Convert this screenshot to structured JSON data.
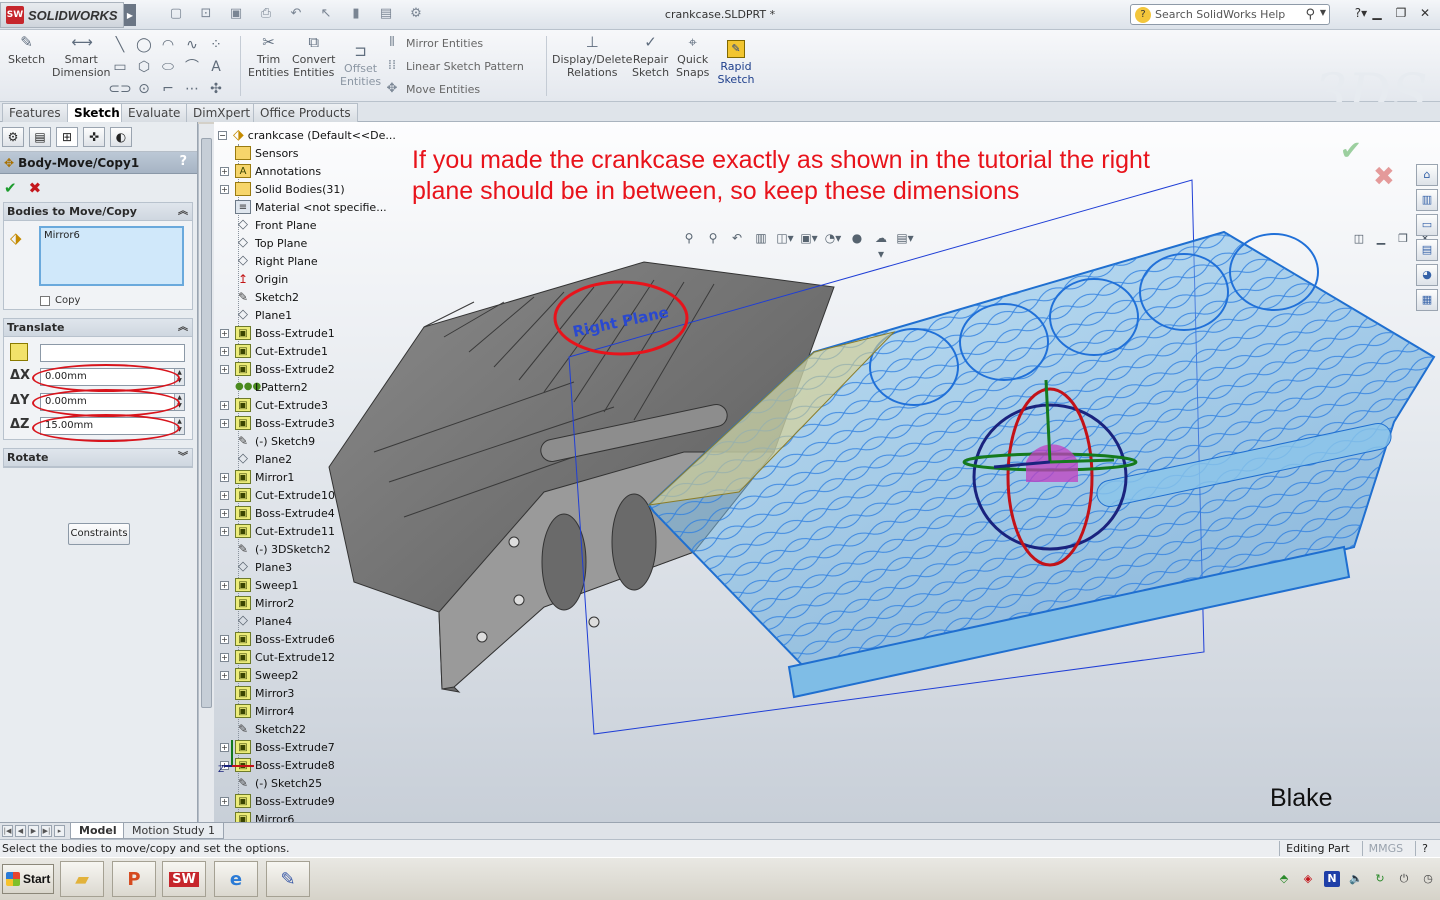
{
  "app": {
    "brand": "SOLIDWORKS",
    "doc_title": "crankcase.SLDPRT *"
  },
  "search": {
    "placeholder": "Search SolidWorks Help"
  },
  "commands": {
    "sketch": "Sketch",
    "smart_dimension_1": "Smart",
    "smart_dimension_2": "Dimension",
    "trim_1": "Trim",
    "trim_2": "Entities",
    "convert_1": "Convert",
    "convert_2": "Entities",
    "offset_1": "Offset",
    "offset_2": "Entities",
    "mirror_entities": "Mirror Entities",
    "linear_pattern": "Linear Sketch Pattern",
    "move_entities": "Move Entities",
    "display_delete_1": "Display/Delete",
    "display_delete_2": "Relations",
    "repair_1": "Repair",
    "repair_2": "Sketch",
    "quick_snaps_1": "Quick",
    "quick_snaps_2": "Snaps",
    "rapid_1": "Rapid",
    "rapid_2": "Sketch"
  },
  "tabs": [
    "Features",
    "Sketch",
    "Evaluate",
    "DimXpert",
    "Office Products"
  ],
  "property_manager": {
    "title": "Body-Move/Copy1",
    "help": "?",
    "bodies_group": "Bodies to Move/Copy",
    "selected_body": "Mirror6",
    "copy_label": "Copy",
    "translate_group": "Translate",
    "dx_label": "ΔX",
    "dy_label": "ΔY",
    "dz_label": "ΔZ",
    "dx": "0.00mm",
    "dy": "0.00mm",
    "dz": "15.00mm",
    "rotate_group": "Rotate",
    "constraints": "Constraints"
  },
  "tree": {
    "root": "crankcase  (Default<<De...",
    "items": [
      {
        "label": "Sensors",
        "icon": "sensor-icon"
      },
      {
        "label": "Annotations",
        "icon": "annotation-icon"
      },
      {
        "label": "Solid Bodies(31)",
        "icon": "folder-icon"
      },
      {
        "label": "Material <not specifie...",
        "icon": "material-icon"
      },
      {
        "label": "Front Plane",
        "icon": "plane-icon"
      },
      {
        "label": "Top Plane",
        "icon": "plane-icon"
      },
      {
        "label": "Right Plane",
        "icon": "plane-icon"
      },
      {
        "label": "Origin",
        "icon": "origin-icon"
      },
      {
        "label": "Sketch2",
        "icon": "sketch-icon"
      },
      {
        "label": "Plane1",
        "icon": "plane-icon"
      },
      {
        "label": "Boss-Extrude1",
        "icon": "feature-icon"
      },
      {
        "label": "Cut-Extrude1",
        "icon": "feature-icon"
      },
      {
        "label": "Boss-Extrude2",
        "icon": "feature-icon"
      },
      {
        "label": "LPattern2",
        "icon": "pattern-icon"
      },
      {
        "label": "Cut-Extrude3",
        "icon": "feature-icon"
      },
      {
        "label": "Boss-Extrude3",
        "icon": "feature-icon"
      },
      {
        "label": "(-) Sketch9",
        "icon": "sketch-icon"
      },
      {
        "label": "Plane2",
        "icon": "plane-icon"
      },
      {
        "label": "Mirror1",
        "icon": "feature-icon"
      },
      {
        "label": "Cut-Extrude10",
        "icon": "feature-icon"
      },
      {
        "label": "Boss-Extrude4",
        "icon": "feature-icon"
      },
      {
        "label": "Cut-Extrude11",
        "icon": "feature-icon"
      },
      {
        "label": "(-) 3DSketch2",
        "icon": "sketch-icon"
      },
      {
        "label": "Plane3",
        "icon": "plane-icon"
      },
      {
        "label": "Sweep1",
        "icon": "feature-icon"
      },
      {
        "label": "Mirror2",
        "icon": "feature-icon"
      },
      {
        "label": "Plane4",
        "icon": "plane-icon"
      },
      {
        "label": "Boss-Extrude6",
        "icon": "feature-icon"
      },
      {
        "label": "Cut-Extrude12",
        "icon": "feature-icon"
      },
      {
        "label": "Sweep2",
        "icon": "feature-icon"
      },
      {
        "label": "Mirror3",
        "icon": "feature-icon"
      },
      {
        "label": "Mirror4",
        "icon": "feature-icon"
      },
      {
        "label": "Sketch22",
        "icon": "sketch-icon"
      },
      {
        "label": "Boss-Extrude7",
        "icon": "feature-icon"
      },
      {
        "label": "Boss-Extrude8",
        "icon": "feature-icon"
      },
      {
        "label": "(-) Sketch25",
        "icon": "sketch-icon"
      },
      {
        "label": "Boss-Extrude9",
        "icon": "feature-icon"
      },
      {
        "label": "Mirror6",
        "icon": "feature-icon"
      }
    ]
  },
  "viewport": {
    "annotation_line1": "If you made the crankcase exactly as shown in the tutorial the right",
    "annotation_line2": "plane should be in between, so keep these dimensions",
    "plane_label": "Right Plane",
    "signature": "Blake",
    "axis_z": "Z"
  },
  "bottom_tabs": [
    "Model",
    "Motion Study 1"
  ],
  "status": {
    "message": "Select the bodies to move/copy and set the options.",
    "editing": "Editing Part",
    "units": "MMGS"
  },
  "taskbar": {
    "start": "Start"
  },
  "colors": {
    "annotation_red": "#e8131b",
    "preview_blue": "#3a8ee8",
    "solid_gray": "#6d6d6d"
  }
}
